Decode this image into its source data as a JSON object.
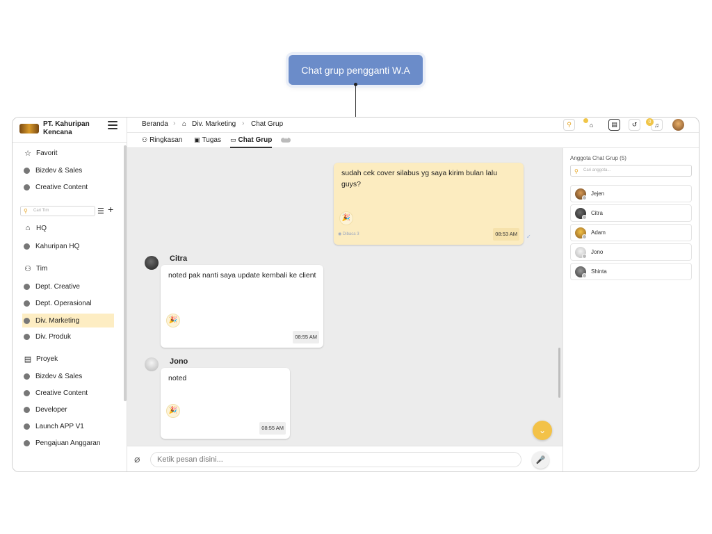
{
  "callout": {
    "text": "Chat grup pengganti W.A"
  },
  "company": {
    "name": "PT. Kahuripan Kencana"
  },
  "sidebar": {
    "favorites_label": "Favorit",
    "favorites": [
      "Bizdev & Sales",
      "Creative Content"
    ],
    "search_placeholder": "Cari Tim",
    "hq_label": "HQ",
    "hq_items": [
      "Kahuripan HQ"
    ],
    "tim_label": "Tim",
    "tim_items": [
      "Dept. Creative",
      "Dept. Operasional",
      "Div. Marketing",
      "Div. Produk"
    ],
    "active_item": "Div. Marketing",
    "proyek_label": "Proyek",
    "proyek_items": [
      "Bizdev & Sales",
      "Creative Content",
      "Developer",
      "Launch APP V1",
      "Pengajuan Anggaran"
    ]
  },
  "breadcrumb": {
    "home": "Beranda",
    "division": "Div. Marketing",
    "current": "Chat Grup"
  },
  "tabs": {
    "summary": "Ringkasan",
    "tasks": "Tugas",
    "chat": "Chat Grup",
    "more": "•••"
  },
  "header": {
    "notification_count": "0"
  },
  "messages": [
    {
      "sender": "",
      "mine": true,
      "text": "sudah cek cover silabus yg saya kirim bulan lalu guys?",
      "time": "08:53 AM",
      "read": "Dibaca 3",
      "reaction": "🎉"
    },
    {
      "sender": "Citra",
      "mine": false,
      "text": "noted pak nanti saya update kembali ke client",
      "time": "08:55 AM",
      "reaction": "🎉"
    },
    {
      "sender": "Jono",
      "mine": false,
      "text": "noted",
      "time": "08:55 AM",
      "reaction": "🎉"
    }
  ],
  "composer": {
    "placeholder": "Ketik pesan disini..."
  },
  "members": {
    "title": "Anggota Chat Grup (5)",
    "search_placeholder": "Cari anggota...",
    "list": [
      "Jejen",
      "Citra",
      "Adam",
      "Jono",
      "Shinta"
    ]
  },
  "colors": {
    "accent": "#f3c248",
    "active_bg": "#fdedc3",
    "own_bubble": "#fcecc0",
    "callout": "#6b8cc9"
  }
}
